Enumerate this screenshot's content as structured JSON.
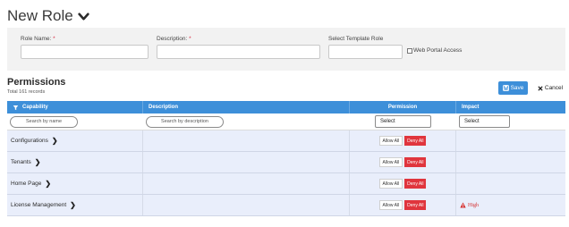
{
  "page": {
    "title": "New Role"
  },
  "form": {
    "role_name_label": "Role Name:",
    "role_name_value": "",
    "description_label": "Description:",
    "description_value": "",
    "required_mark": "*",
    "template_label": "Select Template Role",
    "template_value": "",
    "web_portal_label": "Web Portal Access",
    "web_portal_checked": false
  },
  "permissions": {
    "title": "Permissions",
    "subtitle": "Total 161 records",
    "save_label": "Save",
    "cancel_label": "Cancel",
    "columns": [
      "Capability",
      "Description",
      "Permission",
      "Impact"
    ],
    "filters": {
      "name_placeholder": "Search by name",
      "description_placeholder": "Search by description",
      "permission_select": "Select",
      "impact_select": "Select"
    },
    "allow_all_label": "Allow All",
    "deny_all_label": "Deny All",
    "rows": [
      {
        "capability": "Configurations",
        "description": "",
        "impact": ""
      },
      {
        "capability": "Tenants",
        "description": "",
        "impact": ""
      },
      {
        "capability": "Home Page",
        "description": "",
        "impact": ""
      },
      {
        "capability": "License Management",
        "description": "",
        "impact": "High"
      }
    ]
  },
  "colors": {
    "accent": "#3d8fd9",
    "deny": "#e0353d",
    "row_bg": "#e9eefb",
    "impact_high": "#d32f2f"
  }
}
